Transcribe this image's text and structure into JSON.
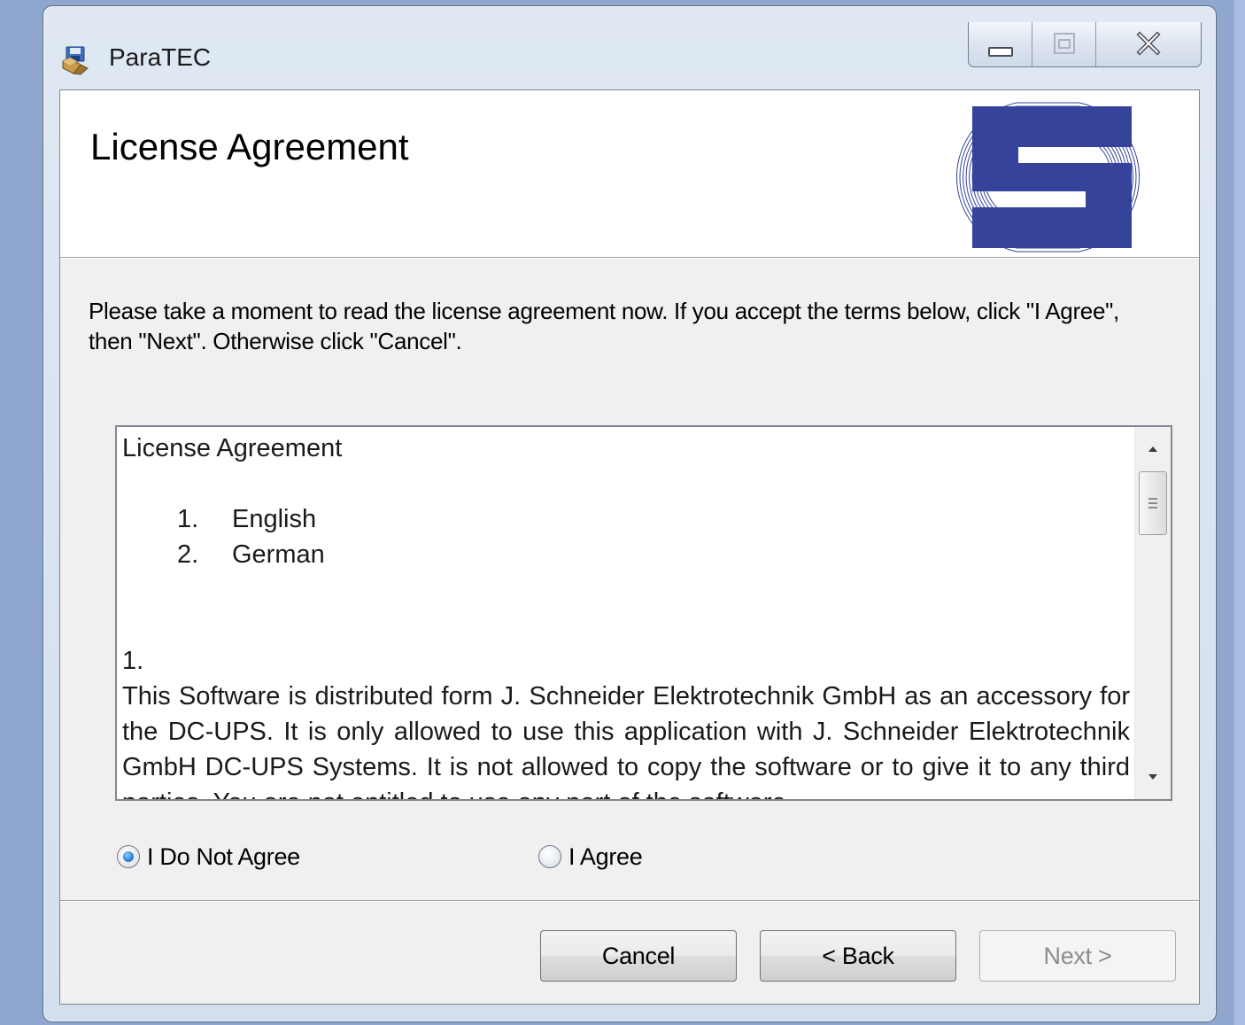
{
  "window": {
    "title": "ParaTEC"
  },
  "banner": {
    "title": "License Agreement"
  },
  "instructions": "Please take a moment to read the license agreement now. If you accept the terms below, click \"I Agree\", then \"Next\". Otherwise click \"Cancel\".",
  "license": {
    "heading": "License Agreement",
    "toc": [
      {
        "num": "1.",
        "label": "English"
      },
      {
        "num": "2.",
        "label": "German"
      }
    ],
    "section_number": "1.",
    "paragraph": "This Software is distributed form J. Schneider Elektrotechnik GmbH as an accessory for the DC-UPS. It is only allowed to use this application with J. Schneider Elektrotechnik GmbH DC-UPS Systems. It is not allowed to copy the software or to give it to any third parties. You are not entitled to use any part of the software."
  },
  "radios": {
    "disagree_label": "I Do Not Agree",
    "agree_label": "I Agree",
    "selected": "disagree"
  },
  "buttons": {
    "cancel": "Cancel",
    "back": "< Back",
    "next": "Next >"
  },
  "colors": {
    "logo_blue": "#35449a",
    "desktop": "#8fa6cf"
  }
}
